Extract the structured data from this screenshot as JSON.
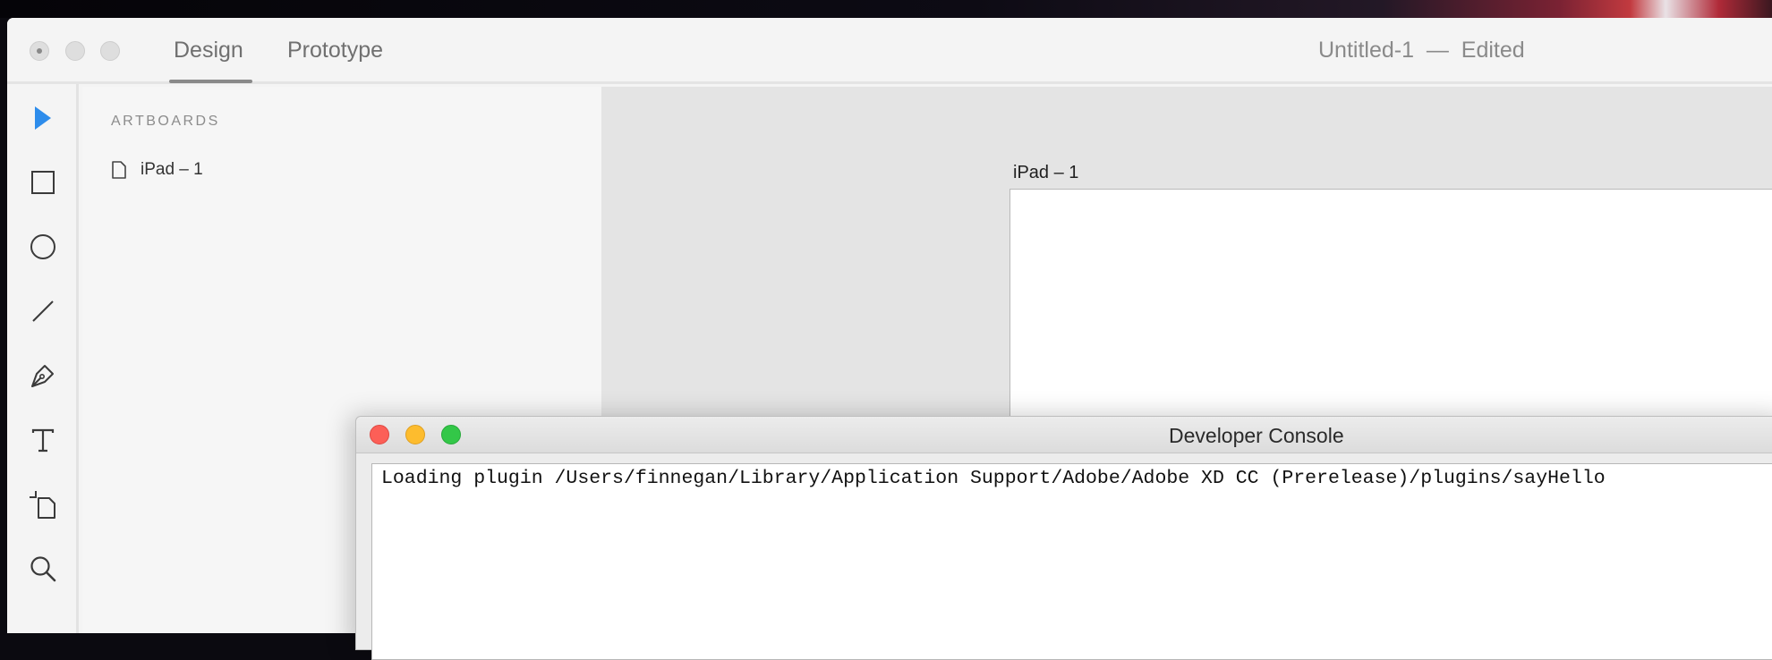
{
  "app": {
    "tabs": [
      {
        "label": "Design",
        "active": true
      },
      {
        "label": "Prototype",
        "active": false
      }
    ],
    "document_title": "Untitled-1  —  Edited"
  },
  "toolbar": {
    "tools": [
      {
        "name": "select",
        "icon": "arrow-pointer-icon",
        "active": true
      },
      {
        "name": "rectangle",
        "icon": "rectangle-icon"
      },
      {
        "name": "ellipse",
        "icon": "ellipse-icon"
      },
      {
        "name": "line",
        "icon": "line-icon"
      },
      {
        "name": "pen",
        "icon": "pen-icon"
      },
      {
        "name": "text",
        "icon": "text-icon"
      },
      {
        "name": "artboard",
        "icon": "artboard-icon"
      },
      {
        "name": "zoom",
        "icon": "magnifier-icon"
      }
    ],
    "accent_color": "#2d8ceb"
  },
  "layers": {
    "heading": "ARTBOARDS",
    "items": [
      {
        "label": "iPad – 1",
        "icon": "page-icon"
      }
    ]
  },
  "canvas": {
    "artboard_label": "iPad – 1"
  },
  "console": {
    "title": "Developer Console",
    "output": "Loading plugin /Users/finnegan/Library/Application Support/Adobe/Adobe XD CC (Prerelease)/plugins/sayHello"
  }
}
